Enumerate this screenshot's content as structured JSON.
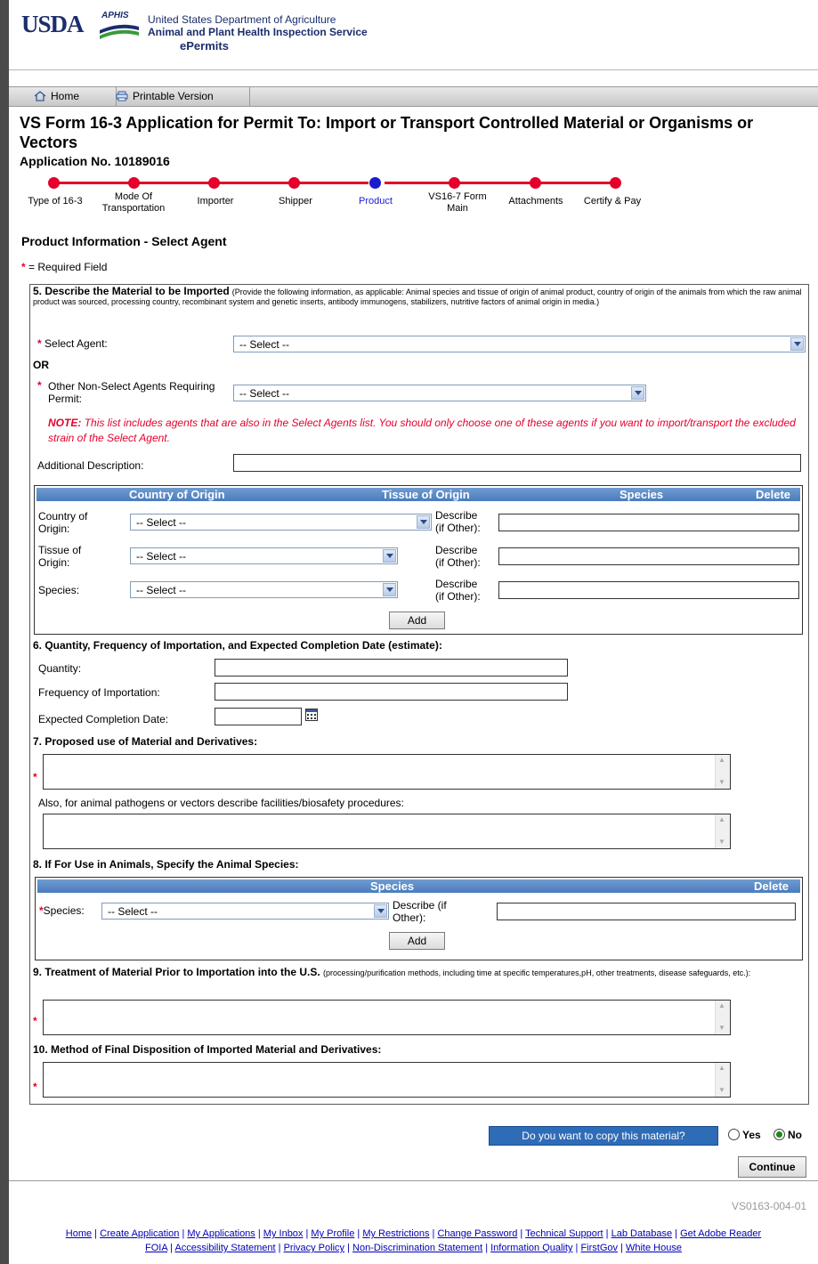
{
  "header": {
    "usda": "USDA",
    "aphis": "APHIS",
    "line1": "United States Department of Agriculture",
    "line2": "Animal and Plant Health Inspection Service",
    "line3": "ePermits"
  },
  "tabs": {
    "home": "Home",
    "printable": "Printable Version"
  },
  "page": {
    "title": "VS Form 16-3 Application for Permit To: Import or Transport Controlled Material or Organisms or Vectors",
    "application_no": "Application No. 10189016"
  },
  "steps": [
    {
      "label": "Type of 16-3"
    },
    {
      "label": "Mode Of Transportation"
    },
    {
      "label": "Importer"
    },
    {
      "label": "Shipper"
    },
    {
      "label": "Product"
    },
    {
      "label": "VS16-7 Form Main"
    },
    {
      "label": "Attachments"
    },
    {
      "label": "Certify & Pay"
    }
  ],
  "product": {
    "section_title": "Product Information - Select Agent",
    "required_note": "= Required Field",
    "q5_title": "5. Describe the Material to be Imported",
    "q5_hint": "(Provide the following information, as applicable: Animal species and tissue of origin of animal product, country of origin of the animals from which the raw animal product was sourced, processing country, recombinant system and genetic inserts, antibody immunogens, stabilizers, nutritive factors of animal origin in media.)",
    "select_agent_label": "Select Agent:",
    "select_agent_value": "-- Select --",
    "or": "OR",
    "other_agents_label": "Other Non-Select Agents Requiring Permit:",
    "other_agents_value": "-- Select --",
    "note_bold": "NOTE:",
    "note_text": "This list includes agents that are also in the Select Agents list.  You should only choose one of these agents if you want to import/transport the excluded strain of the Select Agent.",
    "additional_desc_label": "Additional Description:",
    "origin_table": {
      "headers": [
        "Country of Origin",
        "Tissue of Origin",
        "Species",
        "Delete"
      ],
      "country_label": "Country of Origin:",
      "tissue_label": "Tissue of Origin:",
      "species_label": "Species:",
      "select_value": "-- Select --",
      "describe_label": "Describe (if Other):",
      "add": "Add"
    },
    "q6_title": "6. Quantity, Frequency of Importation, and Expected Completion Date (estimate):",
    "quantity_label": "Quantity:",
    "frequency_label": "Frequency of Importation:",
    "completion_label": "Expected Completion Date:",
    "q7_title": "7. Proposed use of Material and Derivatives:",
    "q7_also": "Also, for animal pathogens or vectors describe facilities/biosafety procedures:",
    "q8_title": "8. If For Use in Animals, Specify the Animal Species:",
    "species_table": {
      "headers": [
        "Species",
        "Delete"
      ],
      "species_label": "Species:",
      "select_value": "-- Select --",
      "describe_label": "Describe (if Other):",
      "add": "Add"
    },
    "q9_title": "9. Treatment of Material Prior to Importation into the U.S.",
    "q9_hint": "(processing/purification methods, including time at specific temperatures,pH, other treatments, disease safeguards, etc.):",
    "q10_title": "10. Method of Final Disposition of Imported Material and Derivatives:"
  },
  "copy": {
    "question": "Do you want to copy this material?",
    "yes": "Yes",
    "no": "No",
    "selected": "No"
  },
  "continue": "Continue",
  "form_id": "VS0163-004-01",
  "footer": {
    "links1": [
      "Home",
      "Create Application",
      "My Applications",
      "My Inbox",
      "My Profile",
      "My Restrictions",
      "Change Password",
      "Technical Support",
      "Lab Database",
      "Get Adobe Reader"
    ],
    "links2": [
      "FOIA",
      "Accessibility Statement",
      "Privacy Policy",
      "Non-Discrimination Statement",
      "Information Quality",
      "FirstGov",
      "White House"
    ]
  },
  "colors": {
    "brand": "#1b2e6c",
    "required": "#e4002b",
    "current_step": "#1b1bd0",
    "table_header": "#4b7cbd"
  }
}
